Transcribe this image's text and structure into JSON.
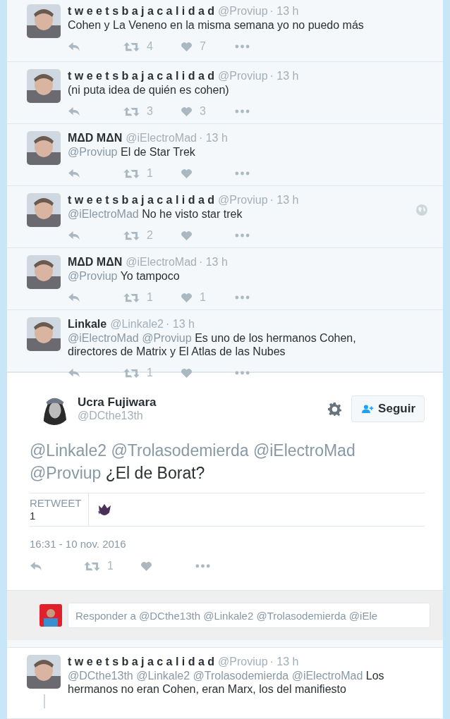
{
  "replies_before": [
    {
      "name": "t w e e t s b a j a c a l i d a d",
      "handle": "@Proviup",
      "time": "· 13 h",
      "text": "Cohen y La Veneno en la misma semana yo no puedo más",
      "retweets": "4",
      "likes": "7"
    },
    {
      "name": "t w e e t s b a j a c a l i d a d",
      "handle": "@Proviup",
      "time": "· 13 h",
      "text": "(ni puta idea de quién es cohen)",
      "retweets": "3",
      "likes": "3"
    },
    {
      "name": "MΔD MΔN",
      "handle": "@iElectroMad",
      "time": "· 13 h",
      "mentions": [
        "@Proviup"
      ],
      "text": "El de Star Trek",
      "retweets": "1"
    },
    {
      "name": "t w e e t s b a j a c a l i d a d",
      "handle": "@Proviup",
      "time": "· 13 h",
      "mentions": [
        "@iElectroMad"
      ],
      "text": "No he visto star trek",
      "retweets": "2",
      "geo": true
    },
    {
      "name": "MΔD MΔN",
      "handle": "@iElectroMad",
      "time": "· 13 h",
      "mentions": [
        "@Proviup"
      ],
      "text": "Yo tampoco",
      "retweets": "1",
      "likes": "1"
    },
    {
      "name": "Linkale",
      "handle": "@Linkale2",
      "time": "· 13 h",
      "mentions": [
        "@iElectroMad",
        "@Proviup"
      ],
      "text": "Es uno de los hermanos Cohen, directores de Matrix y El Atlas de las Nubes",
      "retweets": "1"
    }
  ],
  "main_tweet": {
    "name": "Ucra Fujiwara",
    "handle": "@DCthe13th",
    "follow_button": "Seguir",
    "mentions": [
      "@Linkale2",
      "@Trolasodemierda",
      "@iElectroMad",
      "@Proviup"
    ],
    "text": "¿El de Borat?",
    "stat_label": "RETWEET",
    "stat_count": "1",
    "date": "16:31 - 10 nov. 2016",
    "retweets": "1"
  },
  "reply_box": {
    "placeholder": "Responder a @DCthe13th @Linkale2 @Trolasodemierda @iEle"
  },
  "replies_after": [
    {
      "name": "t w e e t s b a j a c a l i d a d",
      "handle": "@Proviup",
      "time": "· 13 h",
      "mentions": [
        "@DCthe13th",
        "@Linkale2",
        "@Trolasodemierda",
        "@iElectroMad"
      ],
      "text": "Los hermanos no eran Cohen, eran Marx, los del manifiesto",
      "thread": true
    }
  ]
}
